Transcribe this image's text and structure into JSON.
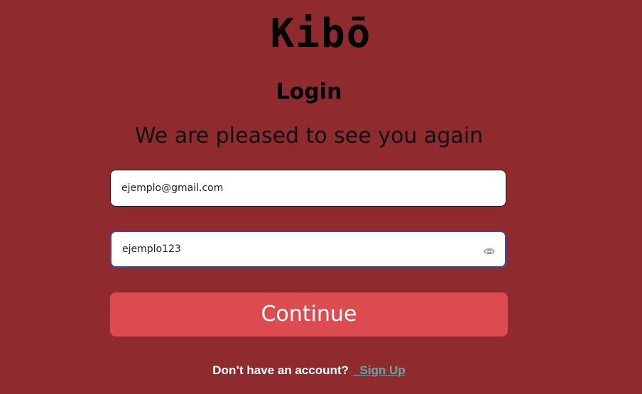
{
  "logo": {
    "text": "Kibō"
  },
  "heading": {
    "title": "Login",
    "subtitle": "We are pleased to see you again"
  },
  "form": {
    "email": {
      "value": "ejemplo@gmail.com"
    },
    "password": {
      "value": "ejemplo123",
      "toggle_icon": "eye-icon"
    },
    "submit_label": "Continue"
  },
  "footer": {
    "prompt": "Don’t have an account?",
    "link_label": "_Sign Up"
  },
  "colors": {
    "background": "#8f2b2f",
    "button": "#db4b4f",
    "link": "#62a7a6",
    "focus_border": "#3b4ca8"
  }
}
